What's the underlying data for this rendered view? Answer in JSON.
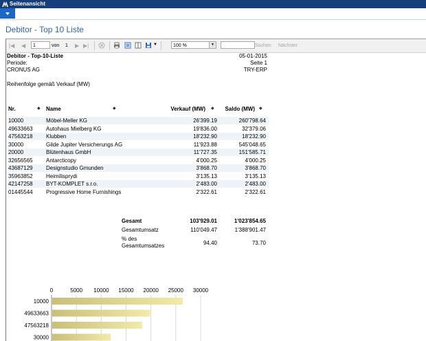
{
  "window": {
    "title": "Seitenansicht"
  },
  "page": {
    "title": "Debitor - Top 10 Liste"
  },
  "toolbar": {
    "page_current": "1",
    "page_of_label": "von",
    "page_total": "1",
    "zoom": "100 %",
    "search_label": "Suchen",
    "next_label": "Nächster"
  },
  "report": {
    "title": "Debitor - Top-10-Liste",
    "date": "05-01-2015",
    "period_label": "Periode:",
    "page_label": "Seite 1",
    "company": "CRONUS AG",
    "user": "TRY-ERP",
    "order_label": "Reihenfolge gemäß Verkauf (MW)",
    "columns": {
      "no": "Nr.",
      "name": "Name",
      "sales": "Verkauf (MW)",
      "balance": "Saldo (MW)"
    },
    "rows": [
      {
        "no": "10000",
        "name": "Möbel-Meller KG",
        "sales": "26'399.19",
        "balance": "260'798.64"
      },
      {
        "no": "49633663",
        "name": "Autohaus Mielberg KG",
        "sales": "19'836.00",
        "balance": "32'379.06"
      },
      {
        "no": "47563218",
        "name": "Klubben",
        "sales": "18'232.90",
        "balance": "18'232.90"
      },
      {
        "no": "30000",
        "name": "Gilde Jupiter Versicherungs AG",
        "sales": "11'923.88",
        "balance": "545'048.65"
      },
      {
        "no": "20000",
        "name": "Blütenhaus GmbH",
        "sales": "11'727.35",
        "balance": "151'585.71"
      },
      {
        "no": "32656565",
        "name": "Antarcticopy",
        "sales": "4'000.25",
        "balance": "4'000.25"
      },
      {
        "no": "43687129",
        "name": "Designstudio Gmunden",
        "sales": "3'868.70",
        "balance": "3'868.70"
      },
      {
        "no": "35963852",
        "name": "Heimilisprydi",
        "sales": "3'135.13",
        "balance": "3'135.13"
      },
      {
        "no": "42147258",
        "name": "BYT-KOMPLET s.r.o.",
        "sales": "2'483.00",
        "balance": "2'483.00"
      },
      {
        "no": "01445544",
        "name": "Progressive Home Furnishings",
        "sales": "2'322.61",
        "balance": "2'322.61"
      }
    ],
    "totals": {
      "total_label": "Gesamt",
      "total_sales": "103'929.01",
      "total_balance": "1'023'854.65",
      "overall_label": "Gesamtumsatz",
      "overall_sales": "110'049.47",
      "overall_balance": "1'388'901.47",
      "pct_label_1": "% des",
      "pct_label_2": "Gesamtumsatzes",
      "pct_sales": "94.40",
      "pct_balance": "73.70"
    }
  },
  "chart_data": {
    "type": "bar",
    "orientation": "horizontal",
    "categories": [
      "10000",
      "49633663",
      "47563218",
      "30000"
    ],
    "values": [
      26399.19,
      19836.0,
      18232.9,
      11923.88
    ],
    "xlim": [
      0,
      30000
    ],
    "xticks": [
      "0",
      "5000",
      "10000",
      "15000",
      "20000",
      "25000",
      "30000"
    ],
    "bar_color": "#d8cf8c"
  }
}
